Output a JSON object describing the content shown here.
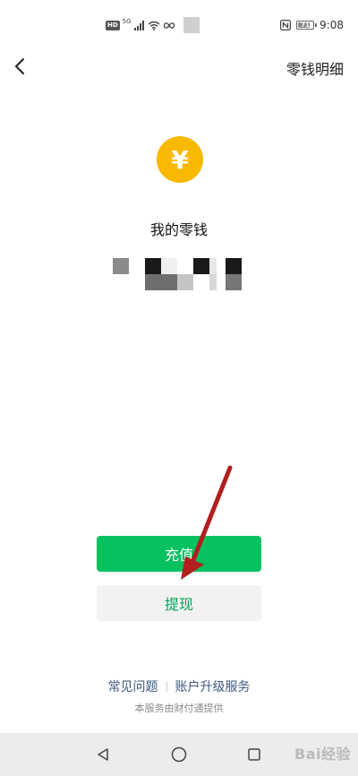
{
  "status_bar": {
    "hd_badge": "HD",
    "network": "5G",
    "battery_level": "71",
    "time": "9:08"
  },
  "header": {
    "detail_link": "零钱明细"
  },
  "wallet": {
    "coin_symbol": "¥",
    "title": "我的零钱"
  },
  "actions": {
    "recharge_label": "充值",
    "withdraw_label": "提现"
  },
  "footer": {
    "faq_link": "常见问题",
    "upgrade_link": "账户升级服务",
    "provider_note": "本服务由财付通提供"
  },
  "watermark": "Bai经验",
  "colors": {
    "brand_green": "#07c160",
    "coin_yellow": "#f8b900",
    "link_blue": "#3d5a80",
    "annotation_red": "#b01e1e"
  }
}
